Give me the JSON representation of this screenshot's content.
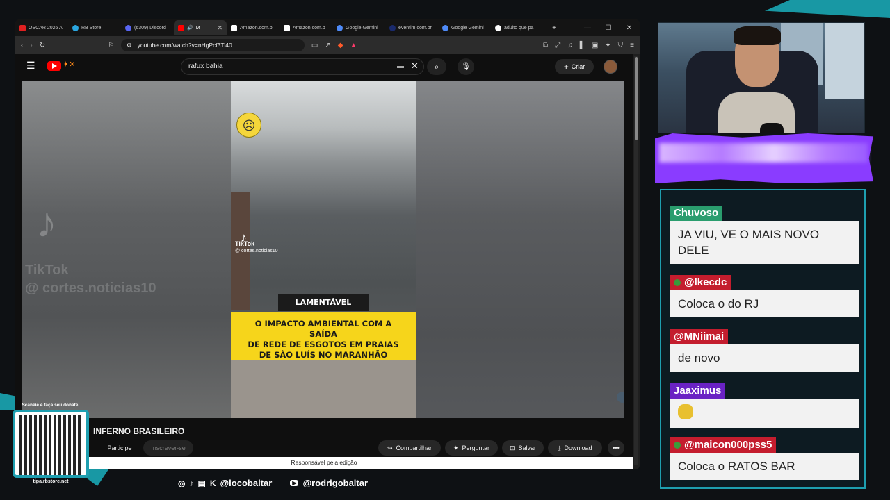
{
  "browser": {
    "tabs": [
      {
        "label": "OSCAR 2026 A",
        "color": "#e02020"
      },
      {
        "label": "RB Store",
        "color": "#2aa6e0"
      },
      {
        "label": "(6309) Discord",
        "color": "#5865f2"
      },
      {
        "label": "M",
        "color": "#ff0000",
        "active": true
      },
      {
        "label": "Amazon.com.b",
        "color": "#ffffff"
      },
      {
        "label": "Amazon.com.b",
        "color": "#ffffff"
      },
      {
        "label": "Google Gemini",
        "color": "#4e8af7"
      },
      {
        "label": "eventim.com.br",
        "color": "#1a2a6c"
      },
      {
        "label": "Google Gemini",
        "color": "#4e8af7"
      },
      {
        "label": "adulto que pa",
        "color": "#ffffff"
      }
    ],
    "url": "youtube.com/watch?v=nHgPcf3Ti40"
  },
  "youtube": {
    "search_value": "rafux bahia",
    "create_label": "Criar",
    "video_title": "INFERNO BRASILEIRO",
    "participe_label": "Participe",
    "subscribe_label": "Inscrever-se",
    "actions": {
      "share": "Compartilhar",
      "ask": "Perguntar",
      "save": "Salvar",
      "download": "Download"
    },
    "edit_bar": "Responsável pela edição"
  },
  "video_overlay": {
    "tiktok_brand": "TikTok",
    "tiktok_handle": "@ cortes.noticias10",
    "label_dark": "LAMENTÁVEL",
    "label_yellow": "O IMPACTO AMBIENTAL COM A SAÍDA\nDE REDE DE ESGOTOS EM PRAIAS\nDE SÃO LUÍS NO MARANHÃO"
  },
  "chat": [
    {
      "user": "Chuvoso",
      "color": "#2a9d6e",
      "badge": false,
      "text": "JA VIU, VE O MAIS NOVO DELE"
    },
    {
      "user": "@lkecdc",
      "color": "#c41d2e",
      "badge": true,
      "text": "Coloca o do RJ"
    },
    {
      "user": "@MNiimai",
      "color": "#c41d2e",
      "badge": false,
      "text": "de novo"
    },
    {
      "user": "Jaaximus",
      "color": "#6a22c4",
      "badge": false,
      "text": ""
    },
    {
      "user": "@maicon000pss5",
      "color": "#c41d2e",
      "badge": true,
      "text": "Coloca o RATOS BAR"
    }
  ],
  "stream": {
    "social_handle_1": "@locobaltar",
    "social_handle_2": "@rodrigobaltar",
    "qr_top": "Scaneie e faça seu donate!",
    "qr_bottom": "tipa.rbstore.net"
  }
}
